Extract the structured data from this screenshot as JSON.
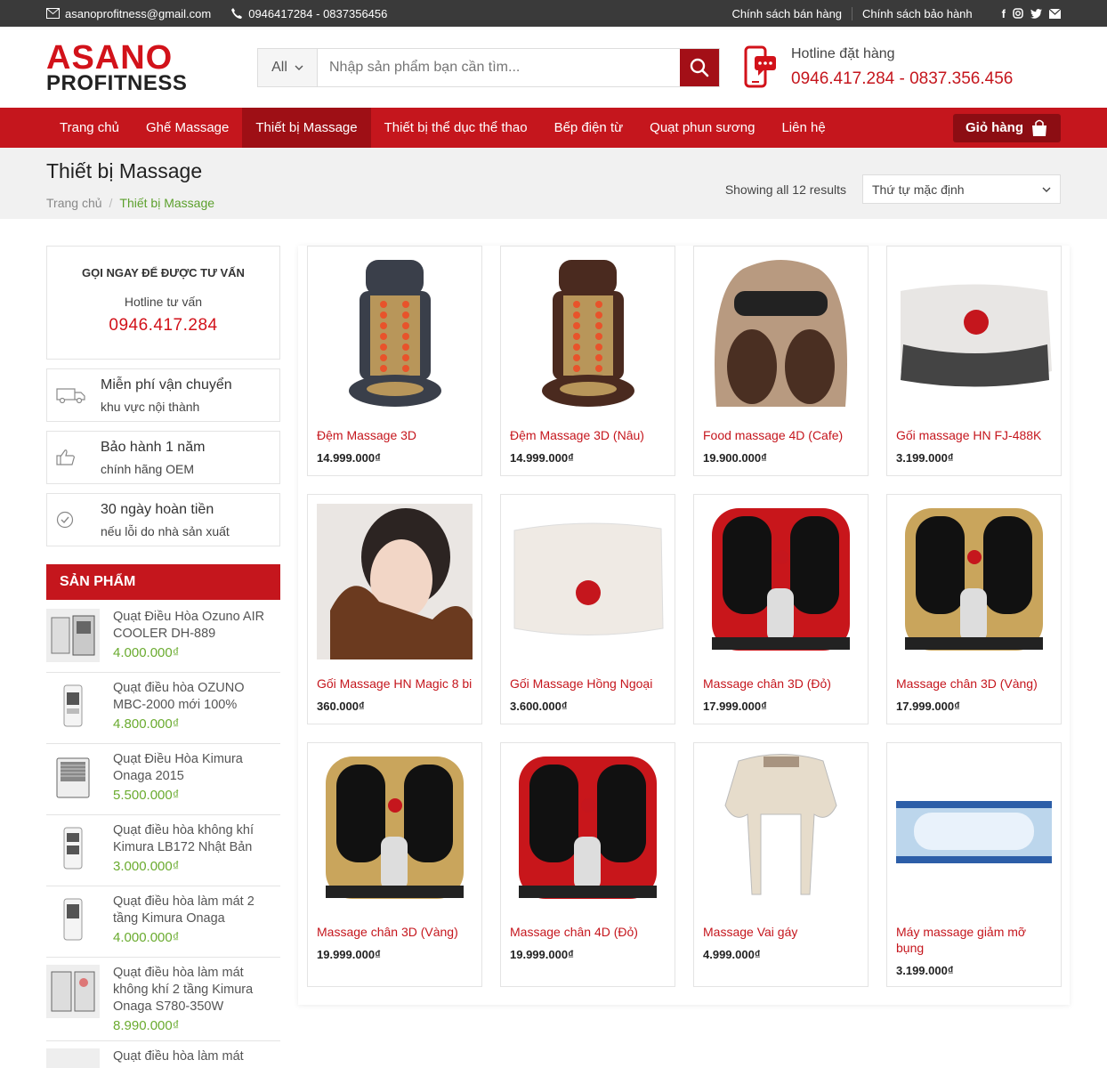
{
  "topbar": {
    "email": "asanoprofitness@gmail.com",
    "phones": "0946417284 - 0837356456",
    "links": [
      "Chính sách bán hàng",
      "Chính sách bảo hành"
    ],
    "social_icons": [
      "facebook-icon",
      "instagram-icon",
      "twitter-icon",
      "mail-icon"
    ]
  },
  "logo": {
    "line1": "ASANO",
    "line2": "PROFITNESS"
  },
  "search": {
    "category": "All",
    "placeholder": "Nhập sản phẩm bạn cần tìm..."
  },
  "hotline": {
    "label": "Hotline đặt hàng",
    "numbers": "0946.417.284 - 0837.356.456"
  },
  "nav": {
    "items": [
      "Trang chủ",
      "Ghế Massage",
      "Thiết bị Massage",
      "Thiết bị thể dục thể thao",
      "Bếp điện từ",
      "Quạt phun sương",
      "Liên hệ"
    ],
    "active_index": 2,
    "cart_label": "Giỏ hàng"
  },
  "titlebar": {
    "title": "Thiết bị Massage",
    "breadcrumb": [
      "Trang chủ",
      "Thiết bị Massage"
    ],
    "breadcrumb_sep": "/",
    "showing": "Showing all 12 results",
    "sort": "Thứ tự mặc định"
  },
  "consult": {
    "heading": "GỌI NGAY ĐỂ ĐƯỢC TƯ VẤN",
    "sub": "Hotline tư vấn",
    "phone": "0946.417.284"
  },
  "features": [
    {
      "icon": "truck-icon",
      "title": "Miễn phí vận chuyển",
      "sub": "khu vực nội thành"
    },
    {
      "icon": "thumbs-up-icon",
      "title": "Bảo hành 1 năm",
      "sub": "chính hãng OEM"
    },
    {
      "icon": "check-circle-icon",
      "title": "30 ngày hoàn tiền",
      "sub": "nếu lỗi do nhà sản xuất"
    }
  ],
  "sidebar_products": {
    "heading": "SẢN PHẨM",
    "items": [
      {
        "name": "Quạt Điều Hòa Ozuno AIR COOLER DH-889",
        "price": "4.000.000₫"
      },
      {
        "name": "Quạt điều hòa OZUNO MBC-2000 mới 100%",
        "price": "4.800.000₫"
      },
      {
        "name": "Quạt Điều Hòa Kimura Onaga 2015",
        "price": "5.500.000₫"
      },
      {
        "name": "Quạt điều hòa không khí Kimura LB172 Nhật Bản",
        "price": "3.000.000₫"
      },
      {
        "name": "Quạt điều hòa làm mát 2 tầng Kimura Onaga",
        "price": "4.000.000₫"
      },
      {
        "name": "Quạt điều hòa làm mát không khí 2 tầng Kimura Onaga S780-350W",
        "price": "8.990.000₫"
      },
      {
        "name": "Quạt điều hòa làm mát",
        "price": ""
      }
    ]
  },
  "products": [
    {
      "name": "Đệm Massage 3D",
      "price": "14.999.000₫",
      "kind": "seat-pad",
      "color": "#3a3f4a"
    },
    {
      "name": "Đệm Massage 3D (Nâu)",
      "price": "14.999.000₫",
      "kind": "seat-pad",
      "color": "#4a2a1f"
    },
    {
      "name": "Food massage 4D (Cafe)",
      "price": "19.900.000₫",
      "kind": "foot-round",
      "color": "#b89a80"
    },
    {
      "name": "Gối massage HN FJ-488K",
      "price": "3.199.000₫",
      "kind": "pillow",
      "color": "#e8e6e4"
    },
    {
      "name": "Gối Massage HN Magic 8 bi",
      "price": "360.000₫",
      "kind": "neck",
      "color": "#6b3a1f"
    },
    {
      "name": "Gối Massage Hồng Ngoại",
      "price": "3.600.000₫",
      "kind": "pillow-plain",
      "color": "#efeae4"
    },
    {
      "name": "Massage chân 3D (Đỏ)",
      "price": "17.999.000₫",
      "kind": "leg",
      "color": "#c8161b"
    },
    {
      "name": "Massage chân 3D (Vàng)",
      "price": "17.999.000₫",
      "kind": "leg",
      "color": "#c9a55c"
    },
    {
      "name": "Massage chân 3D (Vàng)",
      "price": "19.999.000₫",
      "kind": "leg",
      "color": "#c9a55c"
    },
    {
      "name": "Massage chân 4D (Đỏ)",
      "price": "19.999.000₫",
      "kind": "leg",
      "color": "#c8161b"
    },
    {
      "name": "Massage Vai gáy",
      "price": "4.999.000₫",
      "kind": "shoulder",
      "color": "#e6dccb"
    },
    {
      "name": "Máy massage giảm mỡ bụng",
      "price": "3.199.000₫",
      "kind": "belt",
      "color": "#bcd6ec"
    }
  ],
  "colors": {
    "brand": "#c5161d",
    "nav_active": "#9e0f15",
    "price_green": "#6aab2f"
  }
}
